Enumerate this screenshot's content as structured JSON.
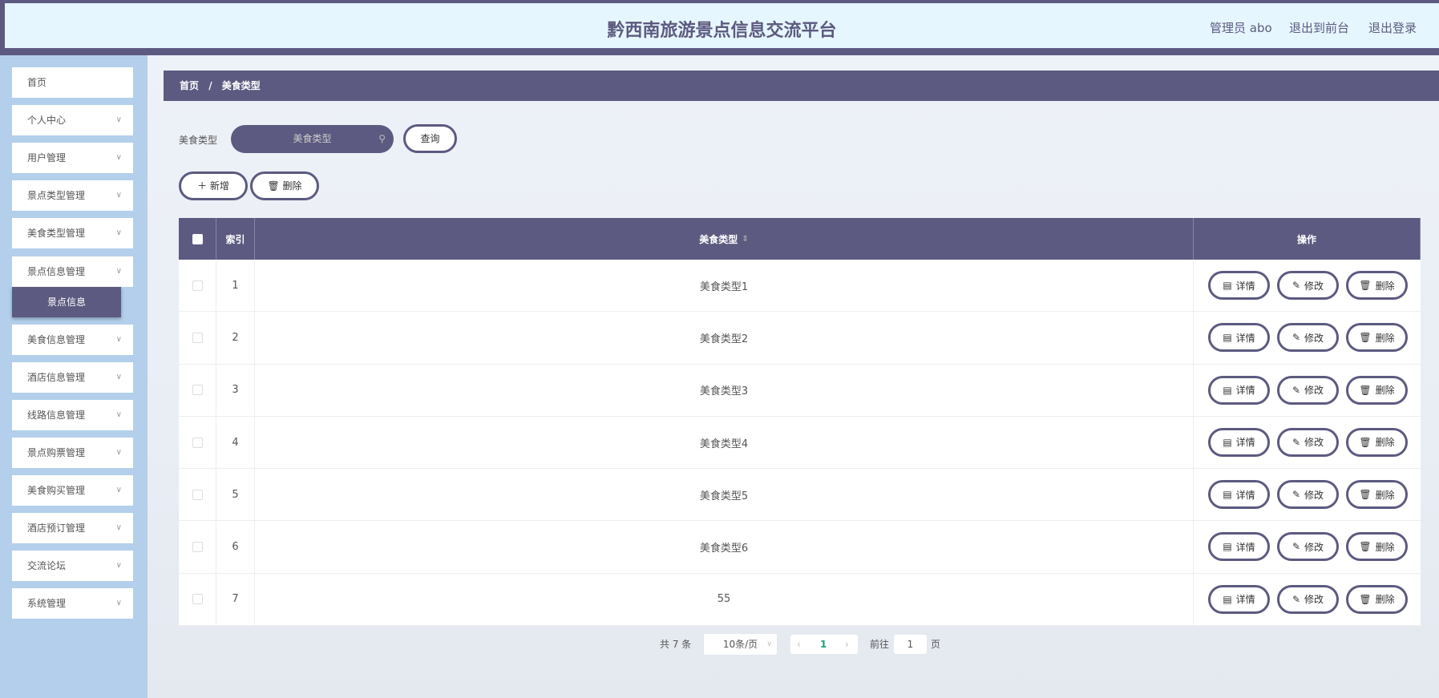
{
  "header": {
    "title": "黔西南旅游景点信息交流平台",
    "user": "管理员 abo",
    "to_front": "退出到前台",
    "logout": "退出登录"
  },
  "sidebar": {
    "items": [
      {
        "label": "首页",
        "chevron": false
      },
      {
        "label": "个人中心",
        "chevron": true
      },
      {
        "label": "用户管理",
        "chevron": true
      },
      {
        "label": "景点类型管理",
        "chevron": true
      },
      {
        "label": "美食类型管理",
        "chevron": true
      },
      {
        "label": "景点信息管理",
        "chevron": true
      },
      {
        "label": "美食信息管理",
        "chevron": true
      },
      {
        "label": "酒店信息管理",
        "chevron": true
      },
      {
        "label": "线路信息管理",
        "chevron": true
      },
      {
        "label": "景点购票管理",
        "chevron": true
      },
      {
        "label": "美食购买管理",
        "chevron": true
      },
      {
        "label": "酒店预订管理",
        "chevron": true
      },
      {
        "label": "交流论坛",
        "chevron": true
      },
      {
        "label": "系统管理",
        "chevron": true
      }
    ],
    "submenu_item": "景点信息"
  },
  "breadcrumb": {
    "home": "首页",
    "sep": "/",
    "current": "美食类型"
  },
  "search": {
    "label": "美食类型",
    "placeholder": "美食类型",
    "query_btn": "查询"
  },
  "actions": {
    "add": "新增",
    "delete": "删除"
  },
  "table": {
    "columns": [
      "索引",
      "美食类型",
      "操作"
    ],
    "rows": [
      {
        "index": "1",
        "name": "美食类型1"
      },
      {
        "index": "2",
        "name": "美食类型2"
      },
      {
        "index": "3",
        "name": "美食类型3"
      },
      {
        "index": "4",
        "name": "美食类型4"
      },
      {
        "index": "5",
        "name": "美食类型5"
      },
      {
        "index": "6",
        "name": "美食类型6"
      },
      {
        "index": "7",
        "name": "55"
      }
    ],
    "row_actions": {
      "detail": "详情",
      "edit": "修改",
      "delete": "删除"
    }
  },
  "pagination": {
    "total": "共 7 条",
    "page_size": "10条/页",
    "current": "1",
    "goto_label": "前往",
    "goto_value": "1",
    "page_suffix": "页"
  },
  "colors": {
    "primary": "#5c5a80",
    "sidebar": "#b3cfeb",
    "header_bg": "#e6f6fe",
    "active_page": "#1aa37a"
  }
}
